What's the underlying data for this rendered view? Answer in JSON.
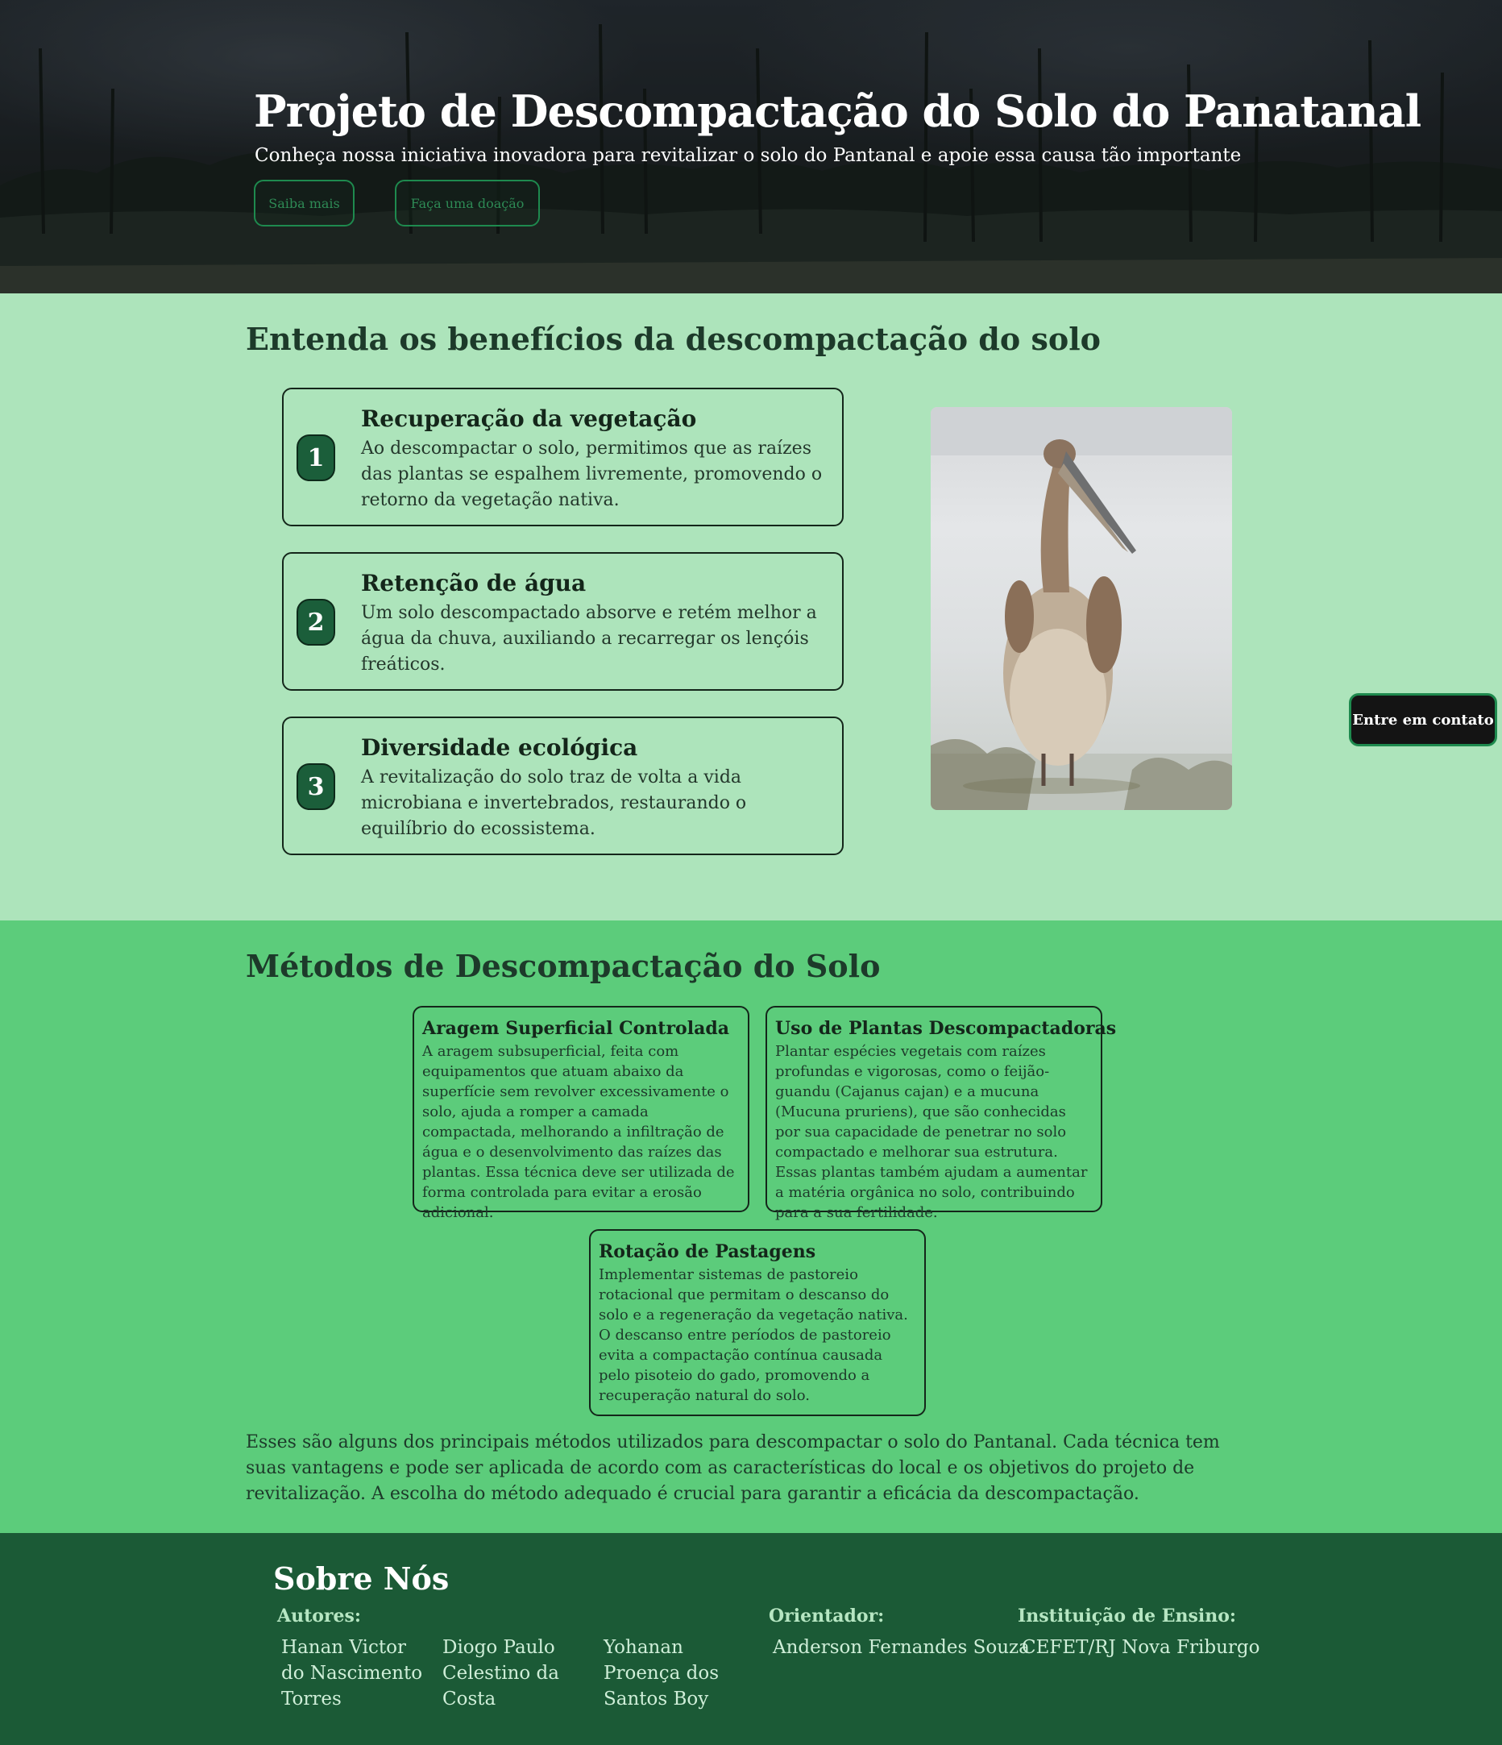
{
  "hero": {
    "title": "Projeto de Descompactação do Solo do Panatanal",
    "subtitle": "Conheça nossa iniciativa inovadora para revitalizar o solo do Pantanal e apoie essa causa tão importante",
    "buttons": {
      "learn_more": "Saiba mais",
      "donate": "Faça uma doação"
    }
  },
  "benefits": {
    "title": "Entenda os benefícios da descompactação do solo",
    "items": [
      {
        "number": "1",
        "title": "Recuperação da vegetação",
        "text": "Ao descompactar o solo, permitimos que as raízes das plantas se espalhem livremente, promovendo o retorno da vegetação nativa."
      },
      {
        "number": "2",
        "title": "Retenção de água",
        "text": "Um solo descompactado absorve e retém melhor a água da chuva, auxiliando a recarregar os lençóis freáticos."
      },
      {
        "number": "3",
        "title": "Diversidade ecológica",
        "text": "A revitalização do solo traz de volta a vida microbiana e invertebrados, restaurando o equilíbrio do ecossistema."
      }
    ]
  },
  "contact_button": "Entre em contato",
  "methods": {
    "title": "Métodos de Descompactação do Solo",
    "items": [
      {
        "title": "Aragem Superficial Controlada",
        "text": "A aragem subsuperficial, feita com equipamentos que atuam abaixo da superfície sem revolver excessivamente o solo, ajuda a romper a camada compactada, melhorando a infiltração de água e o desenvolvimento das raízes das plantas. Essa técnica deve ser utilizada de forma controlada para evitar a erosão adicional."
      },
      {
        "title": "Uso de Plantas Descompactadoras",
        "text": "Plantar espécies vegetais com raízes profundas e vigorosas, como o feijão-guandu (Cajanus cajan) e a mucuna (Mucuna pruriens), que são conhecidas por sua capacidade de penetrar no solo compactado e melhorar sua estrutura. Essas plantas também ajudam a aumentar a matéria orgânica no solo, contribuindo para a sua fertilidade."
      },
      {
        "title": "Rotação de Pastagens",
        "text": "Implementar sistemas de pastoreio rotacional que permitam o descanso do solo e a regeneração da vegetação nativa. O descanso entre períodos de pastoreio evita a compactação contínua causada pelo pisoteio do gado, promovendo a recuperação natural do solo."
      }
    ],
    "summary": "Esses são alguns dos principais métodos utilizados para descompactar o solo do Pantanal. Cada técnica tem suas vantagens e pode ser aplicada de acordo com as características do local e os objetivos do projeto de revitalização. A escolha do método adequado é crucial para garantir a eficácia da descompactação."
  },
  "about": {
    "title": "Sobre Nós",
    "authors_label": "Autores:",
    "authors": [
      "Hanan Victor do Nascimento Torres",
      "Diogo Paulo Celestino da Costa",
      "Yohanan Proença dos Santos Boy"
    ],
    "advisor_label": "Orientador:",
    "advisor": "Anderson Fernandes Souza",
    "institution_label": "Instituição de Ensino:",
    "institution": "CEFET/RJ Nova Friburgo"
  }
}
